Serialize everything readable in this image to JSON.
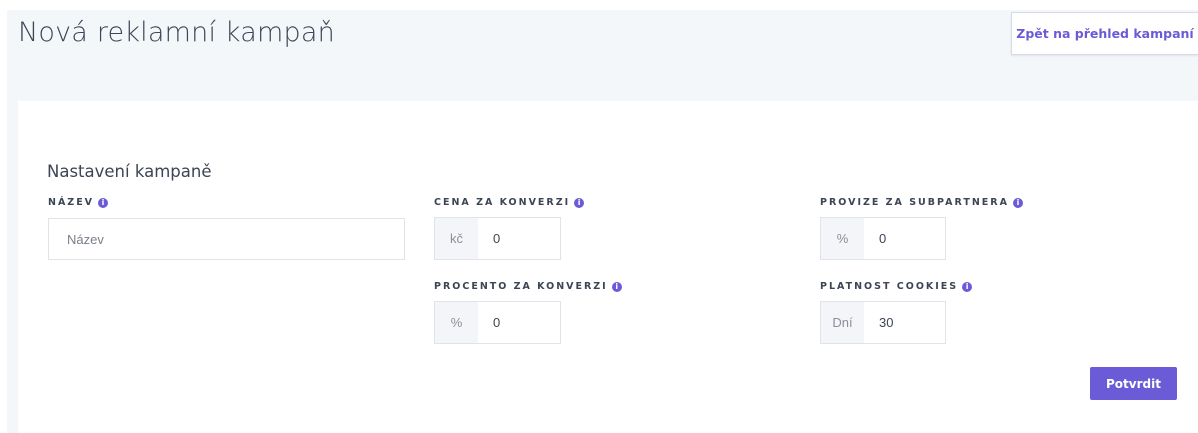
{
  "header": {
    "title": "Nová reklamní kampaň",
    "back_label": "Zpět na přehled kampaní"
  },
  "card": {
    "title": "Nastavení kampaně"
  },
  "fields": {
    "name": {
      "label": "NÁZEV",
      "placeholder": "Název",
      "value": ""
    },
    "price": {
      "label": "CENA ZA KONVERZI",
      "unit": "kč",
      "value": "0"
    },
    "percent": {
      "label": "PROCENTO ZA KONVERZI",
      "unit": "%",
      "value": "0"
    },
    "subpartner": {
      "label": "PROVIZE ZA SUBPARTNERA",
      "unit": "%",
      "value": "0"
    },
    "cookies": {
      "label": "PLATNOST COOKIES",
      "unit": "Dní",
      "value": "30"
    }
  },
  "info_glyph": "i",
  "submit_label": "Potvrdit",
  "colors": {
    "accent": "#6b5bd6",
    "background": "#f4f7fa",
    "text": "#3c4555"
  }
}
